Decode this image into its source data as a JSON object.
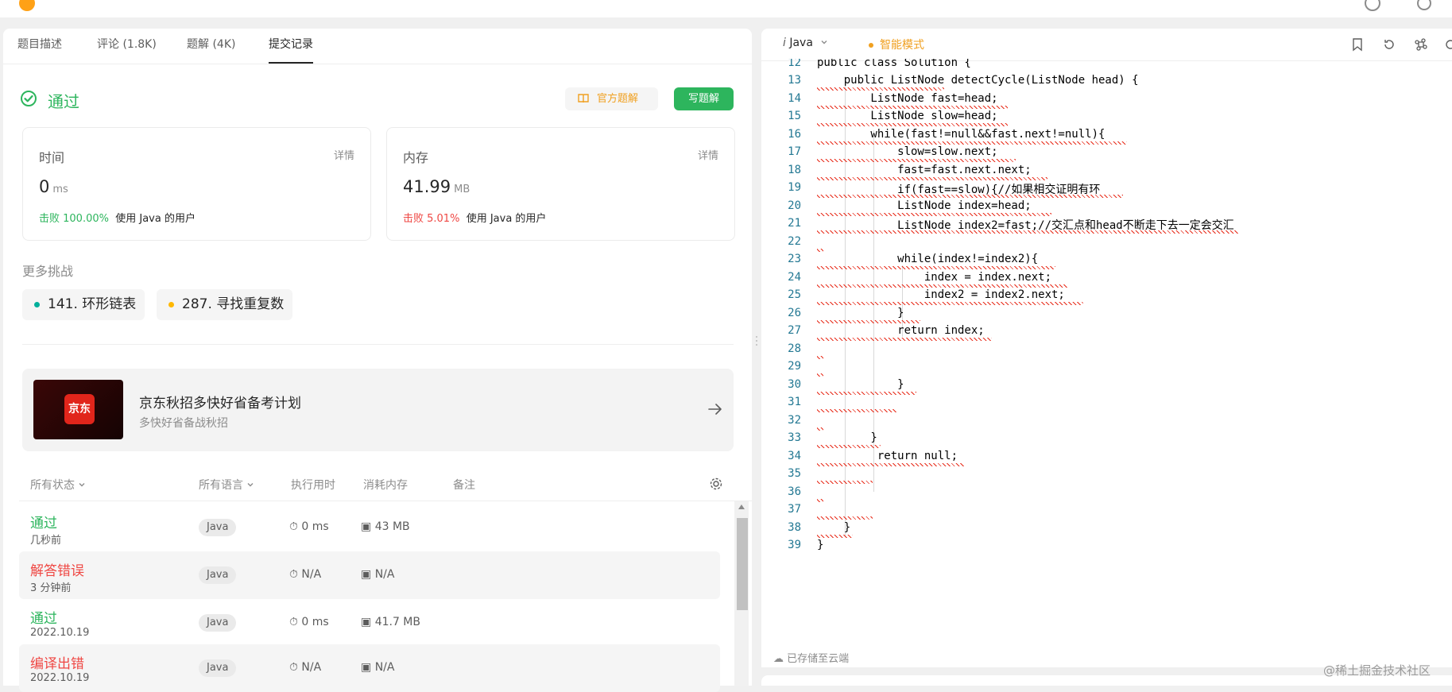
{
  "left": {
    "tabs": [
      "题目描述",
      "评论 (1.8K)",
      "题解 (4K)",
      "提交记录"
    ],
    "status": "通过",
    "buttons": {
      "official": "官方题解",
      "write": "写题解"
    },
    "time_card": {
      "label": "时间",
      "detail": "详情",
      "value": "0",
      "unit": "ms",
      "beat_label": "击败 100.00%",
      "beat_suffix": "使用 Java 的用户"
    },
    "memory_card": {
      "label": "内存",
      "detail": "详情",
      "value": "41.99",
      "unit": "MB",
      "beat_label": "击败 5.01%",
      "beat_suffix": "使用 Java 的用户"
    },
    "more_title": "更多挑战",
    "challenges": [
      {
        "label": "141. 环形链表",
        "color": "#00af9b"
      },
      {
        "label": "287. 寻找重复数",
        "color": "#ffb800"
      }
    ],
    "ad": {
      "logo": "京东",
      "title": "京东秋招多快好省备考计划",
      "subtitle": "多快好省备战秋招"
    },
    "table_headers": [
      "所有状态",
      "所有语言",
      "执行用时",
      "消耗内存",
      "备注"
    ],
    "rows": [
      {
        "status": "通过",
        "time": "几秒前",
        "lang": "Java",
        "runtime": "0 ms",
        "memory": "43 MB",
        "ok": true
      },
      {
        "status": "解答错误",
        "time": "3 分钟前",
        "lang": "Java",
        "runtime": "N/A",
        "memory": "N/A",
        "ok": false
      },
      {
        "status": "通过",
        "time": "2022.10.19",
        "lang": "Java",
        "runtime": "0 ms",
        "memory": "41.7 MB",
        "ok": true
      },
      {
        "status": "编译出错",
        "time": "2022.10.19",
        "lang": "Java",
        "runtime": "N/A",
        "memory": "N/A",
        "ok": false
      }
    ]
  },
  "right": {
    "language": "Java",
    "smart_mode": "智能模式",
    "saved": "已存储至云端",
    "code_lines": [
      {
        "n": "12",
        "text": "public class Solution {"
      },
      {
        "n": "13",
        "text": "    public ListNode detectCycle(ListNode head) {"
      },
      {
        "n": "14",
        "text": "        ListNode fast=head;"
      },
      {
        "n": "15",
        "text": "        ListNode slow=head;"
      },
      {
        "n": "16",
        "text": "        while(fast!=null&&fast.next!=null){"
      },
      {
        "n": "17",
        "text": "            slow=slow.next;"
      },
      {
        "n": "18",
        "text": "            fast=fast.next.next;"
      },
      {
        "n": "19",
        "text": "            if(fast==slow){//如果相交证明有环"
      },
      {
        "n": "20",
        "text": "            ListNode index=head;"
      },
      {
        "n": "21",
        "text": "            ListNode index2=fast;//交汇点和head不断走下去一定会交汇"
      },
      {
        "n": "22",
        "text": ""
      },
      {
        "n": "23",
        "text": "            while(index!=index2){"
      },
      {
        "n": "24",
        "text": "                index = index.next;"
      },
      {
        "n": "25",
        "text": "                index2 = index2.next;"
      },
      {
        "n": "26",
        "text": "            }"
      },
      {
        "n": "27",
        "text": "            return index;"
      },
      {
        "n": "28",
        "text": ""
      },
      {
        "n": "29",
        "text": ""
      },
      {
        "n": "30",
        "text": "            }"
      },
      {
        "n": "31",
        "text": ""
      },
      {
        "n": "32",
        "text": ""
      },
      {
        "n": "33",
        "text": "        }"
      },
      {
        "n": "34",
        "text": "         return null;"
      },
      {
        "n": "35",
        "text": ""
      },
      {
        "n": "36",
        "text": ""
      },
      {
        "n": "37",
        "text": ""
      },
      {
        "n": "38",
        "text": "    }"
      },
      {
        "n": "39",
        "text": "}"
      }
    ]
  },
  "watermark": "@稀土掘金技术社区"
}
